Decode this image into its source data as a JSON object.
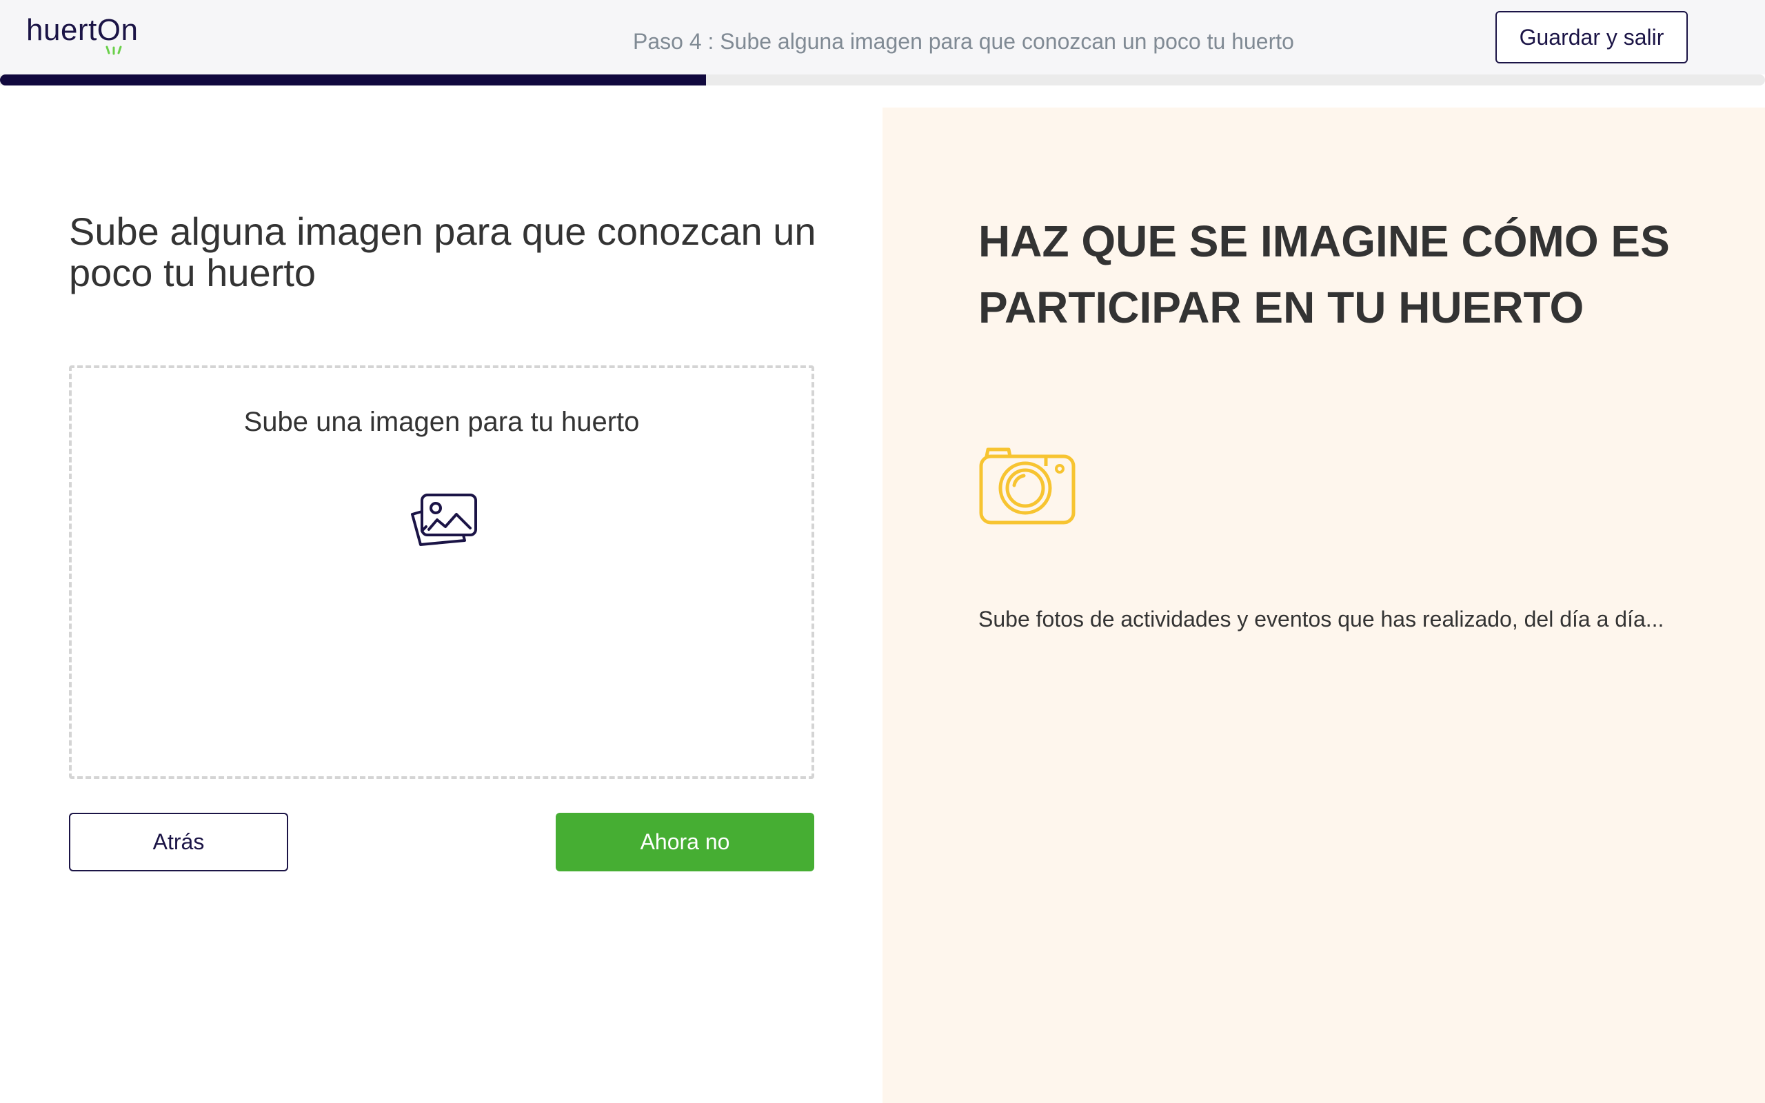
{
  "header": {
    "logo_text": "huertOn",
    "step_text": "Paso 4 : Sube alguna imagen para que conozcan un poco tu huerto",
    "save_exit_label": "Guardar y salir"
  },
  "progress": {
    "fraction": 0.4
  },
  "main": {
    "title": "Sube alguna imagen para que conozcan un poco tu huerto",
    "upload": {
      "label": "Sube una imagen para tu huerto",
      "icon": "images-icon"
    },
    "back_label": "Atrás",
    "skip_label": "Ahora no"
  },
  "tip": {
    "title": "HAZ QUE SE IMAGINE CÓMO ES PARTICIPAR EN TU HUERTO",
    "icon": "camera-icon",
    "description": "Sube fotos de actividades y eventos que has realizado, del día a día..."
  },
  "colors": {
    "brand_dark": "#1b1446",
    "progress_fill": "#11093e",
    "primary_green": "#46ae33",
    "panel_bg": "#fef6ed",
    "camera_yellow": "#f7c431"
  }
}
